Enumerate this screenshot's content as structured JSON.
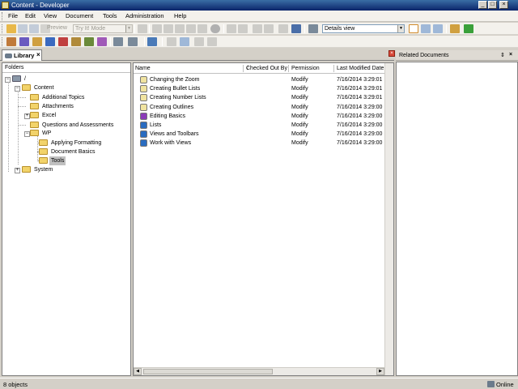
{
  "window": {
    "title": "Content - Developer"
  },
  "menu": [
    "File",
    "Edit",
    "View",
    "Document",
    "Tools",
    "Administration",
    "Help"
  ],
  "toolbar": {
    "preview_label": "Preview",
    "mode_combo": "Try It! Mode",
    "view_combo": "Details view"
  },
  "library_tab": {
    "label": "Library",
    "close": "×"
  },
  "folders": {
    "header": "Folders",
    "root": "/",
    "content": "Content",
    "additional_topics": "Additional Topics",
    "attachments": "Attachments",
    "excel": "Excel",
    "questions": "Questions and Assessments",
    "wp": "WP",
    "applying_formatting": "Applying Formatting",
    "document_basics": "Document Basics",
    "tools": "Tools",
    "system": "System"
  },
  "documents": {
    "columns": {
      "name": "Name",
      "checked_out_by": "Checked Out By",
      "permission": "Permission",
      "last_modified": "Last Modified Date"
    },
    "rows": [
      {
        "name": "Changing the Zoom",
        "checked_out_by": "",
        "permission": "Modify",
        "modified": "7/16/2014 3:29:01",
        "icon": "topic-icon"
      },
      {
        "name": "Creating Bullet Lists",
        "checked_out_by": "",
        "permission": "Modify",
        "modified": "7/16/2014 3:29:01",
        "icon": "topic-icon"
      },
      {
        "name": "Creating Number Lists",
        "checked_out_by": "",
        "permission": "Modify",
        "modified": "7/16/2014 3:29:01",
        "icon": "topic-icon"
      },
      {
        "name": "Creating Outlines",
        "checked_out_by": "",
        "permission": "Modify",
        "modified": "7/16/2014 3:29:00",
        "icon": "topic-icon"
      },
      {
        "name": "Editing Basics",
        "checked_out_by": "",
        "permission": "Modify",
        "modified": "7/16/2014 3:29:00",
        "icon": "module-icon"
      },
      {
        "name": "Lists",
        "checked_out_by": "",
        "permission": "Modify",
        "modified": "7/16/2014 3:29:00",
        "icon": "book-icon"
      },
      {
        "name": "Views and Toolbars",
        "checked_out_by": "",
        "permission": "Modify",
        "modified": "7/16/2014 3:29:00",
        "icon": "book-icon"
      },
      {
        "name": "Work with Views",
        "checked_out_by": "",
        "permission": "Modify",
        "modified": "7/16/2014 3:29:00",
        "icon": "book-icon"
      }
    ]
  },
  "related": {
    "title": "Related Documents",
    "pin": "⇕",
    "close": "×"
  },
  "pane_close": "×",
  "status": {
    "objects": "8 objects",
    "connection": "Online"
  },
  "colors": {
    "title_bar": "#0a246a",
    "selection": "#c0c0c0",
    "folder": "#f2d36a",
    "book": "#2a6cc0",
    "module": "#8a3ab8"
  }
}
